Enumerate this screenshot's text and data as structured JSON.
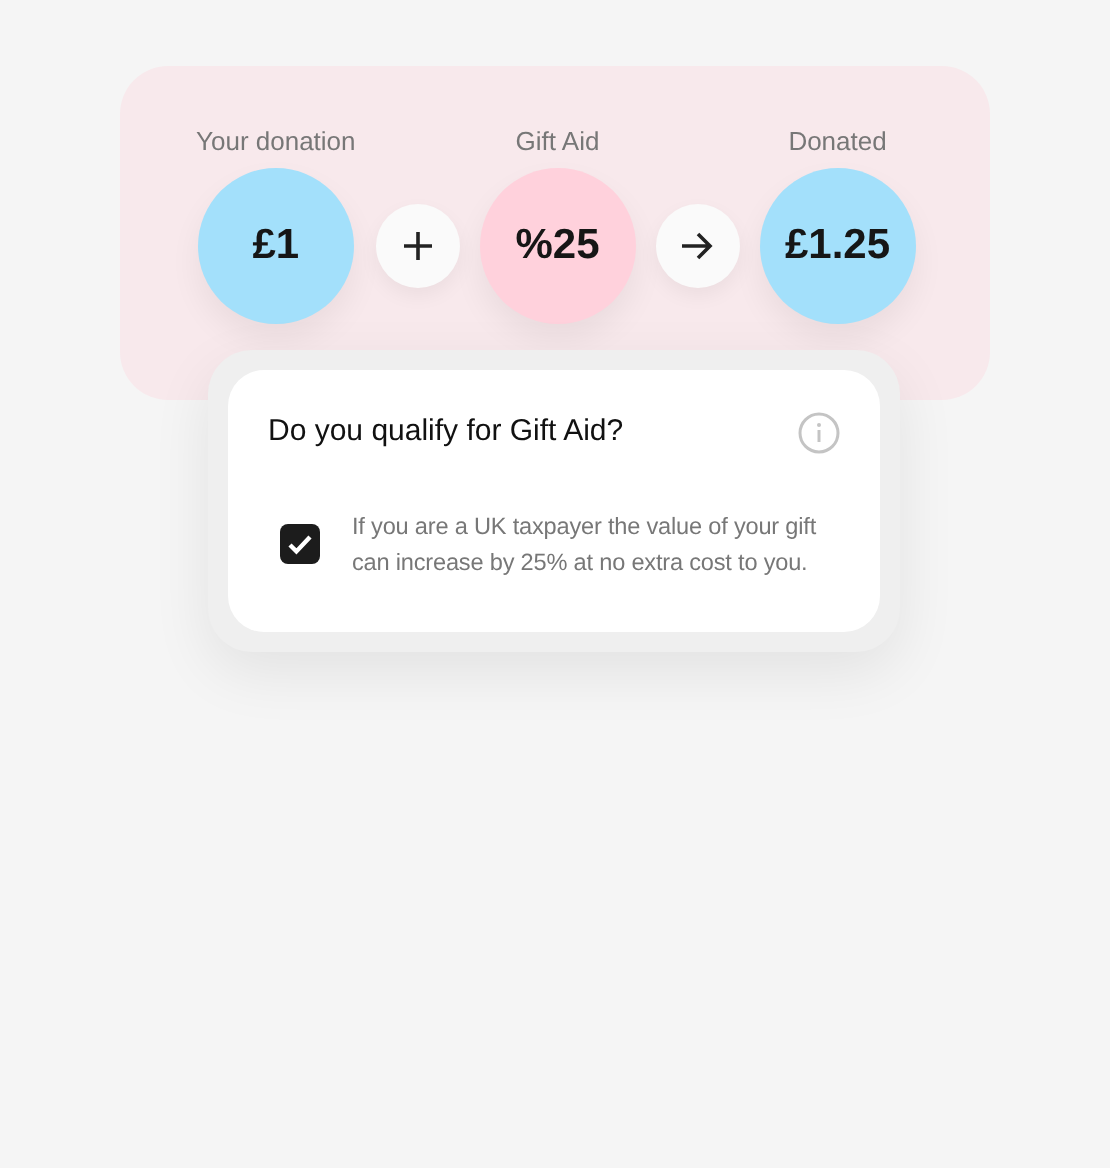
{
  "calculation": [
    {
      "kind": "amount",
      "label": "Your donation",
      "value": "£1",
      "color": "#a3e0fb"
    },
    {
      "kind": "plus"
    },
    {
      "kind": "amount",
      "label": "Gift Aid",
      "value": "%25",
      "color": "#ffd1dc"
    },
    {
      "kind": "arrow"
    },
    {
      "kind": "amount",
      "label": "Donated",
      "value": "£1.25",
      "color": "#a3e0fb"
    }
  ],
  "gift_aid": {
    "title": "Do you qualify for Gift Aid?",
    "checked": true,
    "text": "If you are a UK taxpayer the value of your gift can increase by 25% at no extra cost to you."
  }
}
